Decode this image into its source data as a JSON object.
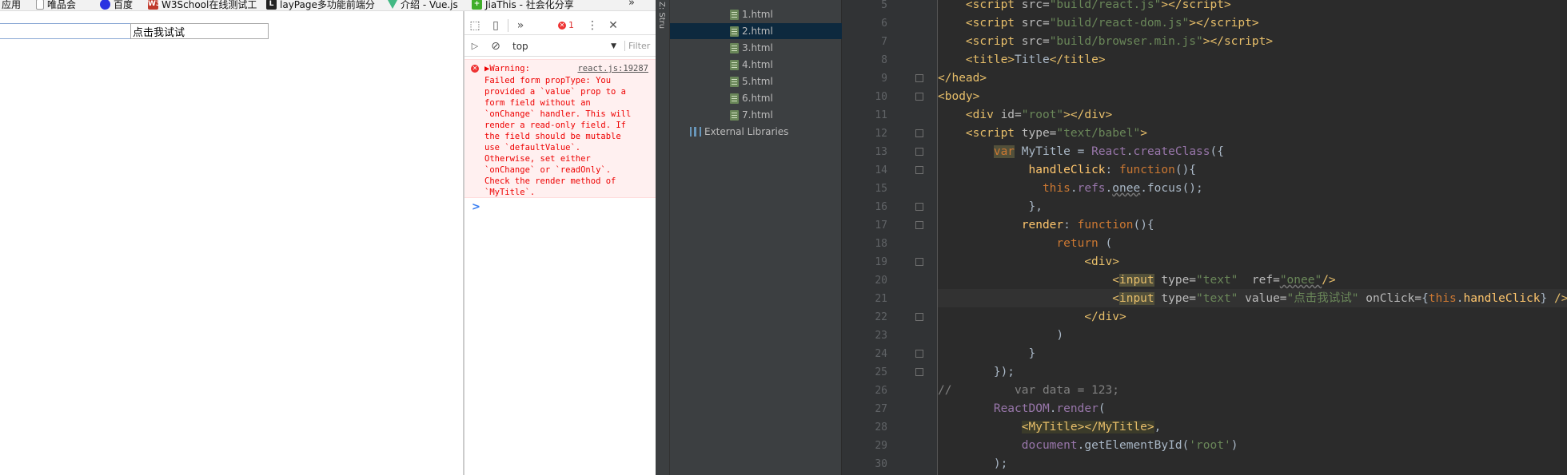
{
  "bookmarks": [
    {
      "label": "应用",
      "icon": "apps-icon",
      "color": "#4285f4"
    },
    {
      "label": "唯品会",
      "icon": "page-icon",
      "color": "#999999"
    },
    {
      "label": "百度",
      "icon": "baidu-icon",
      "color": "#2932e1"
    },
    {
      "label": "W3School在线测试工",
      "icon": "w3school-icon",
      "color": "#c0392b"
    },
    {
      "label": "layPage多功能前端分",
      "icon": "layui-icon",
      "color": "#222222"
    },
    {
      "label": "介绍 - Vue.js",
      "icon": "vue-icon",
      "color": "#41b883"
    },
    {
      "label": "JiaThis - 社会化分享",
      "icon": "jiathis-icon",
      "color": "#3fae29"
    }
  ],
  "bookmarks_more": "»",
  "page": {
    "input_value": "点击我试试"
  },
  "devtools": {
    "more_tabs": "»",
    "error_count": "1",
    "context": "top",
    "filter_placeholder": "Filter",
    "warning_head": "▶Warning:",
    "warning_source": "react.js:19287",
    "warning_message": "Failed form propType: You\nprovided a `value` prop to a\nform field without an\n`onChange` handler. This will\nrender a read-only field. If\nthe field should be mutable\nuse `defaultValue`.\nOtherwise, set either\n`onChange` or `readOnly`.\nCheck the render method of\n`MyTitle`.",
    "prompt": ">"
  },
  "ide": {
    "side_label": "Z: Stru",
    "project_files": [
      "1.html",
      "2.html",
      "3.html",
      "4.html",
      "5.html",
      "6.html",
      "7.html"
    ],
    "selected_file": "2.html",
    "external_libraries": "External Libraries",
    "line_numbers": [
      "5",
      "6",
      "7",
      "8",
      "9",
      "10",
      "11",
      "12",
      "13",
      "14",
      "15",
      "16",
      "17",
      "18",
      "19",
      "20",
      "21",
      "22",
      "23",
      "24",
      "25",
      "26",
      "27",
      "28",
      "29",
      "30"
    ]
  }
}
